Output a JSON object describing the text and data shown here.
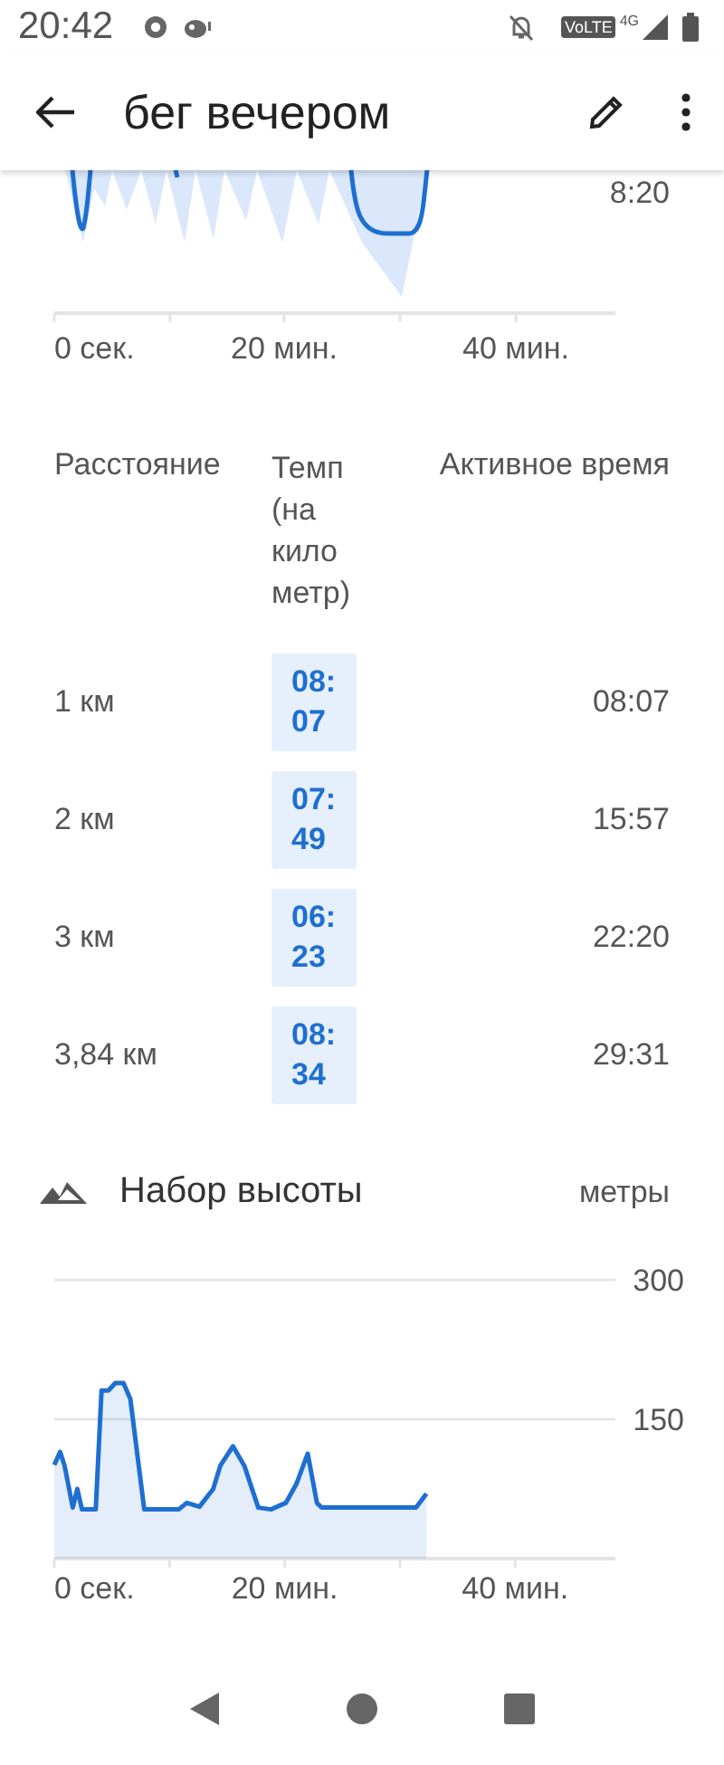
{
  "status_bar": {
    "time": "20:42",
    "network": "VoLTE",
    "generation": "4G"
  },
  "app_bar": {
    "title": "бег вечером"
  },
  "pace_chart": {
    "y_label": "8:20",
    "x_labels": [
      "0 сек.",
      "20 мин.",
      "40 мин."
    ]
  },
  "splits": {
    "columns": [
      "Расстояние",
      "Темп (на километр)",
      "Активное время"
    ],
    "rows": [
      {
        "distance": "1 км",
        "pace": "08:07",
        "time": "08:07"
      },
      {
        "distance": "2 км",
        "pace": "07:49",
        "time": "15:57"
      },
      {
        "distance": "3 км",
        "pace": "06:23",
        "time": "22:20"
      },
      {
        "distance": "3,84 км",
        "pace": "08:34",
        "time": "29:31"
      }
    ]
  },
  "elevation": {
    "title": "Набор высоты",
    "unit": "метры",
    "chart_data": {
      "type": "area",
      "x": [
        0,
        0.5,
        0.9,
        1.6,
        2.0,
        2.4,
        2.8,
        3.6,
        4.1,
        4.7,
        5.3,
        6.0,
        6.6,
        7.8,
        10.8,
        11.5,
        12.6,
        13.8,
        14.4,
        15.5,
        16.5,
        17.7,
        18.8,
        20.1,
        21.0,
        22.0,
        22.8,
        23.2,
        26.7,
        31.4,
        32.3
      ],
      "series": [
        {
          "color": "#1e6fd0",
          "values": [
            101,
            115,
            100,
            55,
            75,
            53,
            53,
            53,
            181,
            181,
            189,
            189,
            172,
            53,
            53,
            60,
            56,
            75,
            100,
            121,
            100,
            55,
            53,
            60,
            80,
            113,
            60,
            55,
            55,
            55,
            70
          ]
        }
      ],
      "xlim": [
        0,
        48.7
      ],
      "ylim": [
        0,
        300
      ],
      "xticks": [
        {
          "value": 0,
          "label": "0 сек."
        },
        {
          "value": 20,
          "label": "20 мин."
        },
        {
          "value": 40,
          "label": "40 мин."
        }
      ],
      "yticks": [
        150,
        300
      ]
    }
  }
}
